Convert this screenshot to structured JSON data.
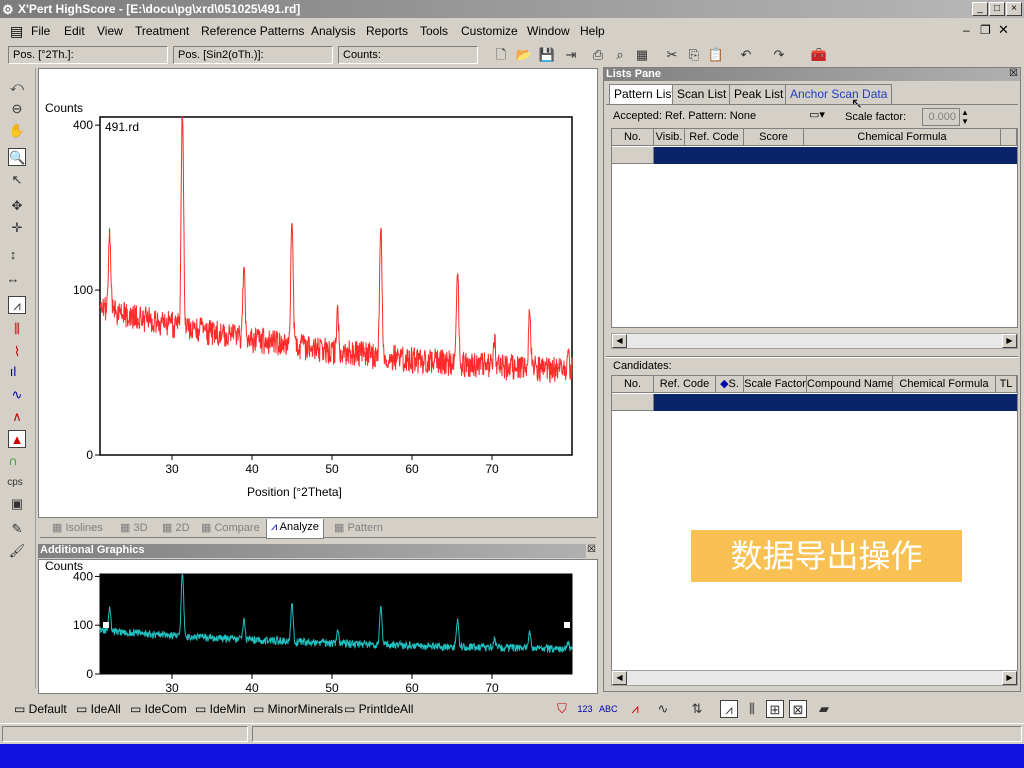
{
  "window": {
    "title": "X'Pert HighScore - [E:\\docu\\pg\\xrd\\051025\\491.rd]",
    "min": "_",
    "max": "□",
    "close": "×"
  },
  "menu": [
    "File",
    "Edit",
    "View",
    "Treatment",
    "Reference Patterns",
    "Analysis",
    "Reports",
    "Tools",
    "Customize",
    "Window",
    "Help"
  ],
  "toolbar": {
    "pos2th": "Pos. [°2Th.]:",
    "possin": "Pos. [Sin2(oTh.)]:",
    "counts": "Counts:"
  },
  "main_plot": {
    "ylabel": "Counts",
    "file_label": "491.rd",
    "xlabel": "Position [°2Theta]",
    "yticks": [
      "400",
      "100",
      "0"
    ],
    "xticks": [
      "30",
      "40",
      "50",
      "60",
      "70"
    ]
  },
  "view_tabs": [
    "Isolines",
    "3D",
    "2D",
    "Compare",
    "Analyze",
    "Pattern"
  ],
  "additional": {
    "title": "Additional Graphics",
    "ylabel": "Counts",
    "yticks": [
      "400",
      "100",
      "0"
    ],
    "xticks": [
      "30",
      "40",
      "50",
      "60",
      "70"
    ]
  },
  "lists_pane": {
    "title": "Lists Pane",
    "tabs": [
      "Pattern List",
      "Scan List",
      "Peak List",
      "Anchor Scan Data"
    ],
    "accepted": "Accepted: Ref. Pattern: None",
    "scale_label": "Scale factor:",
    "scale_value": "0.000",
    "columns": [
      "No.",
      "Visib.",
      "Ref. Code",
      "Score",
      "Chemical Formula"
    ],
    "candidates_label": "Candidates:",
    "cand_columns": [
      "No.",
      "Ref. Code",
      "S.",
      "Scale Factor",
      "Compound Name",
      "Chemical Formula",
      "TL"
    ]
  },
  "banner": "数据导出操作",
  "presets": [
    "Default",
    "IdeAll",
    "IdeCom",
    "IdeMin",
    "MinorMinerals",
    "PrintIdeAll"
  ],
  "colors": {
    "main_trace": "#ff2a2a",
    "add_trace": "#20c0c0",
    "banner": "#f9c154",
    "selected_row": "#0a246a"
  },
  "chart_data": {
    "type": "line",
    "xlabel": "Position [°2Theta]",
    "ylabel": "Counts",
    "xlim": [
      21,
      80
    ],
    "y_scale": "sqrt",
    "peaks": [
      {
        "x": 22.2,
        "y": 150
      },
      {
        "x": 31.3,
        "y": 420
      },
      {
        "x": 39.0,
        "y": 110
      },
      {
        "x": 45.0,
        "y": 190
      },
      {
        "x": 50.7,
        "y": 60
      },
      {
        "x": 56.1,
        "y": 180
      },
      {
        "x": 65.7,
        "y": 110
      },
      {
        "x": 70.3,
        "y": 40
      },
      {
        "x": 74.7,
        "y": 65
      },
      {
        "x": 79.5,
        "y": 30
      }
    ],
    "background": {
      "start_y": 60,
      "end_y": 20
    }
  }
}
